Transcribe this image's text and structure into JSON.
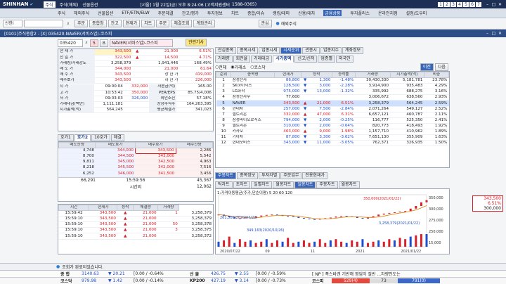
{
  "topbar": {
    "brand": "SHINHAN",
    "menu": [
      "주식",
      "주식(해외)",
      "선물옵션"
    ],
    "info": "[서울] 1월 22일(금) 오후 8:24:06 (고객지원센터",
    "phone": "1588-0365)",
    "nums": [
      "1",
      "2",
      "3",
      "4",
      "5",
      "6",
      "7"
    ]
  },
  "menubar": {
    "items": [
      "주식",
      "해외주식",
      "선물옵션",
      "ETF/ETN/ELW",
      "주문체결",
      "잔고/평가",
      "투자정보",
      "차트",
      "종합/이슈",
      "랭킹/테마",
      "신용/대차",
      "금융상품",
      "투자플러스",
      "온라인지점",
      "설정/도우미"
    ]
  },
  "toolbar": {
    "account": "신한i",
    "buttons": [
      "주문",
      "종합창",
      "잔고",
      "현재가",
      "차트",
      "주문",
      "체결조회",
      "계좌관리"
    ],
    "right": "해외주식",
    "favorite": "관심"
  },
  "window": {
    "title": "[0101]주식종합2 - [X] 035420-NAVER(서비스업)-코스피"
  },
  "stock": {
    "code": "035420",
    "name": "NAVER(서비스업)-코스피",
    "button": "관련기사",
    "f": "5",
    "b": "B"
  },
  "quote": [
    [
      "현 재 가",
      "343,500",
      "▲",
      "21,000",
      "6.51%"
    ],
    [
      "전 일 가",
      "322,500",
      "▲",
      "14,500",
      "4.71%"
    ],
    [
      "거래량/거래강도",
      "3,258,379",
      "",
      "1,941,446",
      "168.49%"
    ],
    [
      "매 도 가",
      "344,000",
      "",
      "21,000",
      "61.64"
    ],
    [
      "매 수 가",
      "343,500",
      "",
      "상 한 가",
      "419,000"
    ],
    [
      "매수호가",
      "343,500",
      "",
      "하 한 가",
      "226,000"
    ]
  ],
  "ohlc": [
    [
      "시 가",
      "09:00:04",
      "332,000",
      "자본금(억)",
      "165.00"
    ],
    [
      "고 가",
      "10:53:42",
      "350,000",
      "PER/EPS",
      "85.75/4,006"
    ],
    [
      "저 가",
      "09:03:03",
      "326,000",
      "외인소진",
      "57.18%"
    ],
    [
      "거래대금(백만)",
      "1,111,181",
      "",
      "상장주식수",
      "164,263,395"
    ],
    [
      "시가총액(억)",
      "564,245",
      "",
      "평균체결가",
      "341,023"
    ]
  ],
  "lefttabs": [
    "호가1",
    "호가2",
    "10호가",
    "체결"
  ],
  "orderbook": {
    "headers": [
      "매도잔량",
      "매도호가",
      "매수호가",
      "매수잔량"
    ],
    "rows": [
      [
        "4,748",
        "344,000",
        "343,500",
        "2,286"
      ],
      [
        "8,700",
        "344,500",
        "343,000",
        "5,542"
      ],
      [
        "9,811",
        "345,000",
        "342,500",
        "4,963"
      ],
      [
        "8,218",
        "345,500",
        "342,000",
        "7,516"
      ],
      [
        "6,252",
        "346,000",
        "341,500",
        "3,456"
      ]
    ],
    "total_ask": "66,291",
    "time": "15:59:56",
    "total_bid": "45,367",
    "after": "시간외",
    "after_val": "12,062"
  },
  "trades": {
    "headers": [
      "시간",
      "현재가",
      "등락",
      "체결량",
      "거래량"
    ],
    "rows": [
      [
        "15:59:42",
        "343,500",
        "▲",
        "21,000",
        "1",
        "3,258,379"
      ],
      [
        "15:59:10",
        "343,500",
        "▲",
        "21,000",
        "",
        "3,258,379"
      ],
      [
        "15:59:10",
        "343,500",
        "▲",
        "21,000",
        "50",
        "3,258,378"
      ],
      [
        "15:59:10",
        "343,500",
        "▲",
        "21,000",
        "3",
        "3,258,375"
      ],
      [
        "15:59:10",
        "343,500",
        "▲",
        "21,000",
        "",
        "3,258,372"
      ]
    ]
  },
  "righttabs": [
    "관심종목",
    "종목시세",
    "업종시세",
    "시세순위",
    "관종시",
    "업종지수",
    "계좌정보"
  ],
  "rankingtabs": [
    "거래량",
    "회전율",
    "거래대금",
    "시가총액",
    "신고/신저",
    "업종별",
    "외국인"
  ],
  "rankfilter": {
    "all": "전체",
    "kospi": "거래소",
    "kosdaq": "코스닥",
    "prev": "이전",
    "next": "다음"
  },
  "ranking": {
    "headers": [
      "순위",
      "종목명",
      "현재가",
      "등락",
      "등락률",
      "거래량",
      "시가총액(억)",
      "비중"
    ],
    "rows": [
      [
        "1",
        "삼성전자",
        "86,800",
        "▼",
        "1,300",
        "-1.48%",
        "30,430,330",
        "5,181,781",
        "23.78%"
      ],
      [
        "2",
        "SK하이닉스",
        "128,500",
        "▼",
        "3,000",
        "-2.28%",
        "3,914,900",
        "935,483",
        "4.29%"
      ],
      [
        "3",
        "LG화학",
        "975,000",
        "▼",
        "13,000",
        "-1.32%",
        "335,992",
        "688,275",
        "3.16%"
      ],
      [
        "4",
        "삼성전자우",
        "77,600",
        "",
        "",
        "",
        "3,006,672",
        "638,560",
        "2.93%"
      ],
      [
        "5",
        "NAVER",
        "343,500",
        "▲",
        "21,000",
        "6.51%",
        "3,258,379",
        "564,245",
        "2.59%"
      ],
      [
        "6",
        "현대차",
        "257,000",
        "▼",
        "7,500",
        "-2.84%",
        "2,071,264",
        "549,127",
        "2.52%"
      ],
      [
        "7",
        "셀트리온",
        "332,000",
        "▲",
        "47,000",
        "6.31%",
        "6,657,121",
        "460,787",
        "2.11%"
      ],
      [
        "8",
        "삼성바이오로직스",
        "794,000",
        "▼",
        "2,000",
        "-0.25%",
        "116,777",
        "525,350",
        "2.41%"
      ],
      [
        "9",
        "셀트리온",
        "310,000",
        "▼",
        "2,000",
        "-0.64%",
        "820,773",
        "418,493",
        "1.92%"
      ],
      [
        "10",
        "카카오",
        "463,000",
        "▲",
        "9,000",
        "1.98%",
        "1,157,710",
        "410,962",
        "1.89%"
      ],
      [
        "11",
        "기아차",
        "87,800",
        "▼",
        "3,300",
        "-3.62%",
        "7,651,130",
        "355,909",
        "1.63%"
      ],
      [
        "12",
        "현대모비스",
        "343,000",
        "▼",
        "11,000",
        "-3.05%",
        "762,371",
        "326,935",
        "1.50%"
      ]
    ]
  },
  "charttabs": [
    "주봉차트",
    "종목정보",
    "투자자별",
    "주문업무",
    "전용현재가"
  ],
  "chartsubtabs": [
    "틱차트",
    "초차트",
    "일별차트",
    "월봉차트",
    "일봉차트",
    "주봉차트",
    "월봉차트"
  ],
  "chart_data": {
    "type": "line",
    "title": "1:가격이동평균(주가,단순이평) 5 20 60 120",
    "annotations": [
      "350,000(2021/01/22)",
      "261,500(2020/07/22)",
      "3,258,379(2021/01/22)",
      "349,163(2020/10/26)"
    ],
    "xticks": [
      "2020/07/22",
      "09",
      "11",
      "2021",
      "2021/01/22"
    ],
    "yticks": [
      "350,000",
      "300,000",
      "275,000",
      "250,000",
      "15,000"
    ],
    "series": [
      {
        "name": "price",
        "x": [
          0,
          1,
          2,
          3,
          4,
          5,
          6,
          7,
          8,
          9,
          10,
          11,
          12,
          13,
          14,
          15,
          16,
          17,
          18,
          19,
          20,
          21,
          22,
          23,
          24,
          25,
          26,
          27,
          28,
          29,
          30,
          31,
          32,
          33,
          34,
          35,
          36,
          37,
          38,
          39
        ],
        "values": [
          300,
          296,
          292,
          288,
          289,
          291,
          290,
          294,
          297,
          299,
          300,
          298,
          296,
          295,
          293,
          290,
          288,
          286,
          285,
          287,
          289,
          291,
          294,
          296,
          295,
          293,
          290,
          288,
          291,
          295,
          300,
          303,
          305,
          307,
          309,
          311,
          318,
          326,
          337,
          343.5
        ]
      }
    ],
    "volume": [
      0.4,
      0.5,
      0.8,
      0.3,
      0.6,
      0.4,
      0.5,
      0.3,
      0.4,
      0.6,
      0.3,
      0.5,
      0.4,
      0.7,
      0.3,
      0.4,
      0.5,
      0.3,
      0.4,
      0.6,
      0.3,
      0.5,
      0.6,
      0.4,
      0.3,
      0.5,
      0.4,
      0.6,
      0.3,
      0.4,
      0.5,
      0.4,
      0.6,
      0.5,
      0.7,
      0.6,
      0.8,
      0.9,
      1.0,
      1.0
    ],
    "ylim": [
      250,
      360
    ]
  },
  "pricebox": {
    "p1": "343,500",
    "p2": "6.51%",
    "p3": "300,000"
  },
  "statusbar": {
    "msg": "조회가 완료되었습니다."
  },
  "ticker1": {
    "label1": "종 합",
    "v1": "3140.63",
    "c1": "▼ 20.21",
    "c2": "[0.00 / -0.64%",
    "label2": "선 물",
    "v2": "426.75",
    "c3": "▼ 2.55",
    "c4": "[0.00 / -0.59%",
    "news": "[ NP ] 폭스바겐 기반해 영업익 절반 ...차량인도는"
  },
  "ticker2": {
    "label1": "코스닥",
    "v1": "979.98",
    "c1": "▼ 1.42",
    "c2": "[0.00 / -0.14%",
    "label2": "KP200",
    "v2": "427.19",
    "c3": "▼ 3.14",
    "c4": "[0.00 / -0.73%",
    "label3": "코스피",
    "up": "529(4)",
    "mid": "73",
    "down": "791(0)"
  },
  "colors": {
    "up": "#d8202a",
    "down": "#1f4fd0",
    "accent": "#2d4d86"
  }
}
